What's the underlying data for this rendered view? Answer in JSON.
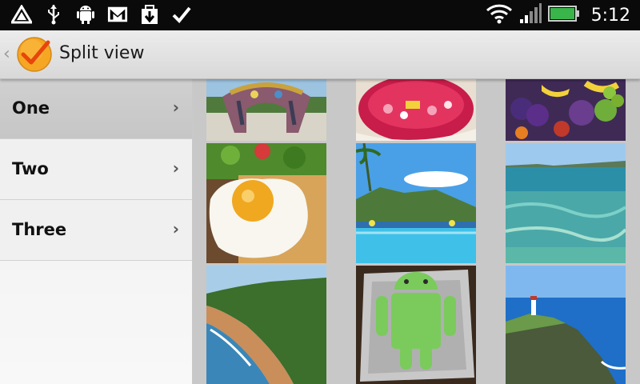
{
  "statusbar": {
    "clock": "5:12",
    "icons_left": [
      "alert-triangle-icon",
      "usb-icon",
      "android-debug-icon",
      "gmail-icon",
      "download-icon",
      "check-icon"
    ],
    "icons_right": [
      "wifi-icon",
      "signal-icon",
      "battery-icon"
    ]
  },
  "actionbar": {
    "title": "Split view",
    "app_icon": "checkmark-circle-icon"
  },
  "sidebar": {
    "items": [
      {
        "label": "One",
        "selected": true
      },
      {
        "label": "Two",
        "selected": false
      },
      {
        "label": "Three",
        "selected": false
      }
    ]
  },
  "grid": {
    "thumbnails": [
      "sculpture-photo",
      "flowers-photo",
      "fruit-market-photo",
      "fried-egg-photo",
      "resort-pool-photo",
      "ocean-shore-photo",
      "coastline-photo",
      "android-cake-photo",
      "lighthouse-cliff-photo"
    ]
  },
  "colors": {
    "statusbar_bg": "#0a0a0a",
    "actionbar_bg": "#e4e4e4",
    "selected_item_bg": "#cbcbcb",
    "battery_green": "#39b54a",
    "app_icon_orange": "#f5a623"
  }
}
